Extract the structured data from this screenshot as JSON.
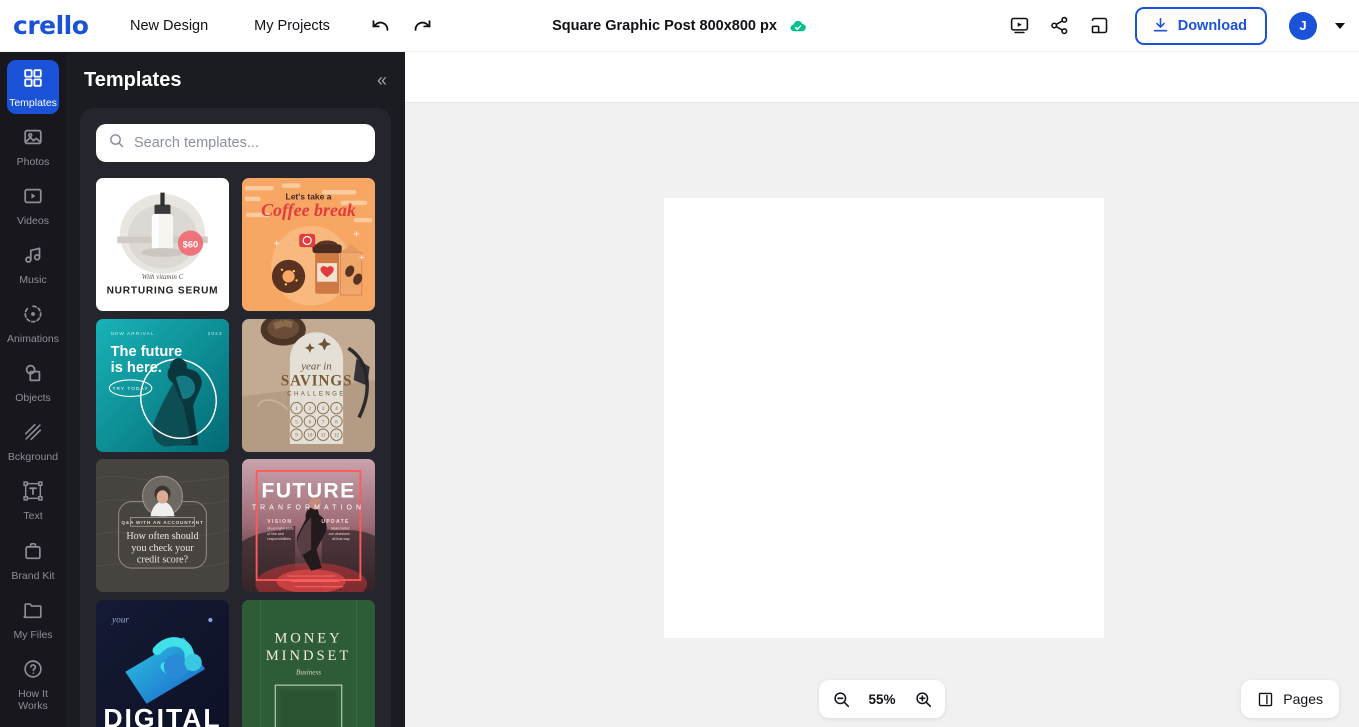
{
  "header": {
    "logo": "crello",
    "nav": [
      {
        "label": "New Design",
        "name": "nav-new-design"
      },
      {
        "label": "My Projects",
        "name": "nav-my-projects"
      }
    ],
    "undo_title": "Undo",
    "redo_title": "Redo",
    "doc_title": "Square Graphic Post 800x800 px",
    "saved_status": "Saved to cloud",
    "right_icons": [
      {
        "name": "present-icon",
        "title": "Present"
      },
      {
        "name": "share-icon",
        "title": "Share"
      },
      {
        "name": "save-to-folder-icon",
        "title": "Save to folder"
      }
    ],
    "download_label": "Download",
    "avatar_initial": "J",
    "accent_color": "#1a53d8"
  },
  "rail": {
    "items": [
      {
        "label": "Templates",
        "icon": "templates-icon",
        "active": true
      },
      {
        "label": "Photos",
        "icon": "photos-icon",
        "active": false
      },
      {
        "label": "Videos",
        "icon": "videos-icon",
        "active": false
      },
      {
        "label": "Music",
        "icon": "music-icon",
        "active": false
      },
      {
        "label": "Animations",
        "icon": "animations-icon",
        "active": false
      },
      {
        "label": "Objects",
        "icon": "objects-icon",
        "active": false
      },
      {
        "label": "Bckground",
        "icon": "background-icon",
        "active": false
      },
      {
        "label": "Text",
        "icon": "text-icon",
        "active": false
      },
      {
        "label": "Brand Kit",
        "icon": "brand-kit-icon",
        "active": false
      },
      {
        "label": "My Files",
        "icon": "my-files-icon",
        "active": false
      },
      {
        "label": "How It Works",
        "icon": "help-icon",
        "active": false
      }
    ]
  },
  "panel": {
    "title": "Templates",
    "collapse_label": "«",
    "search": {
      "placeholder": "Search templates...",
      "value": ""
    },
    "templates": [
      {
        "name": "template-nurturing-serum",
        "title": "NURTURING SERUM",
        "subtitle": "With vitamin C",
        "badge": "$60",
        "theme": "white"
      },
      {
        "name": "template-coffee-break",
        "title": "Coffee break",
        "subtitle": "Let's take a",
        "theme": "orange"
      },
      {
        "name": "template-the-future-is-here",
        "title": "The future is here.",
        "subtitle": "TRY TODAY",
        "theme": "teal"
      },
      {
        "name": "template-year-in-savings",
        "title": "SAVINGS",
        "subtitle": "year in",
        "caption": "CHALLENGE",
        "theme": "beige"
      },
      {
        "name": "template-credit-score",
        "title": "How often should you check your credit score?",
        "badge": "Q&A WITH AN ACCOUNTANT",
        "theme": "dark-gray"
      },
      {
        "name": "template-future-transformation",
        "title": "FUTURE",
        "subtitle": "TRANFORMATION",
        "theme": "red"
      },
      {
        "name": "template-your-digital",
        "title": "DIGITAL",
        "subtitle": "your",
        "theme": "navy"
      },
      {
        "name": "template-money-mindset",
        "title": "MONEY MINDSET",
        "subtitle": "Business",
        "theme": "green"
      }
    ]
  },
  "canvas": {
    "zoom_level": "55%",
    "zoom_out_title": "Zoom out",
    "zoom_in_title": "Zoom in",
    "pages_label": "Pages",
    "artboard_color": "#ffffff",
    "background_color": "#f1f1f1"
  }
}
